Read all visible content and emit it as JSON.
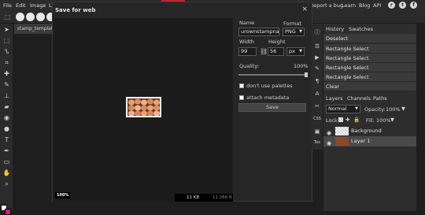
{
  "menubar": {
    "items": [
      "File",
      "Edit",
      "Image",
      "L"
    ],
    "right_items": [
      "Report a bug",
      "Learn",
      "Blog",
      "API"
    ]
  },
  "doc_tab": "stamp_template",
  "dialog": {
    "title": "Save for web",
    "close": "×",
    "zoom": "100%",
    "file_size": "11 KB",
    "file_size_secondary": "11.266 B",
    "name_label": "Name",
    "name_value": "urownstampname",
    "format_label": "Format",
    "format_value": "PNG",
    "width_label": "Width",
    "width_value": "99",
    "height_label": "Height",
    "height_value": "56",
    "unit_value": "px",
    "quality_label": "Quality:",
    "quality_value": "100%",
    "quality_level": 1.0,
    "dont_use_palettes": "don't use palettes",
    "attach_metadata": "attach metadata",
    "save_label": "Save"
  },
  "history": {
    "tabs": [
      "History",
      "Swatches"
    ],
    "rows": [
      "Deselect",
      "Rectangle Select",
      "Rectangle Select",
      "Rectangle Select",
      "Rectangle Select",
      "Clear"
    ]
  },
  "layers": {
    "tabs": [
      "Layers",
      "Channels",
      "Paths"
    ],
    "blend_mode": "Normal",
    "opacity_label": "Opacity:",
    "opacity_value": "100%",
    "lock_label": "Lock:",
    "fill_label": "Fill:",
    "fill_value": "100%",
    "rows": [
      {
        "name": "Background"
      },
      {
        "name": "Layer 1"
      }
    ]
  },
  "right_tools": [
    "CSS",
    "Tex"
  ],
  "colors": {
    "accent_red": "#c0262d",
    "foreground": "#ffffff",
    "background_swatch": "#e0157a"
  }
}
